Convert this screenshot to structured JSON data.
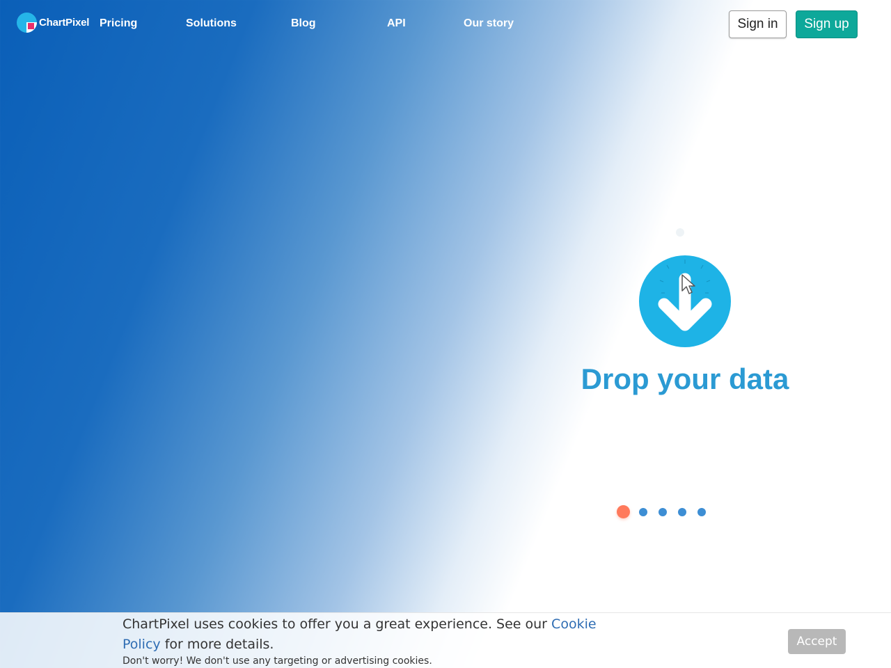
{
  "header": {
    "logo_text": "ChartPixel",
    "nav": {
      "pricing": "Pricing",
      "solutions": "Solutions",
      "blog": "Blog",
      "api": "API",
      "our_story": "Our story"
    },
    "sign_in": "Sign in",
    "sign_up": "Sign up"
  },
  "hero": {
    "title": "Drop your data",
    "icon": "download-arrow-icon",
    "accent_color": "#1eb3e6",
    "title_color": "#2b9ad3",
    "carousel": {
      "slide_count": 5,
      "active_index": 0,
      "active_color": "#ff7a5c",
      "dot_color": "#3d8ed4"
    }
  },
  "cookie": {
    "text_before": "ChartPixel uses cookies to offer you a great experience. See our ",
    "link": "Cookie Policy",
    "text_after": " for more details.",
    "note": "Don't worry! We don't use any targeting or advertising cookies.",
    "accept": "Accept"
  },
  "colors": {
    "brand_blue": "#1a6cbf",
    "signup_teal": "#0ea89a"
  }
}
